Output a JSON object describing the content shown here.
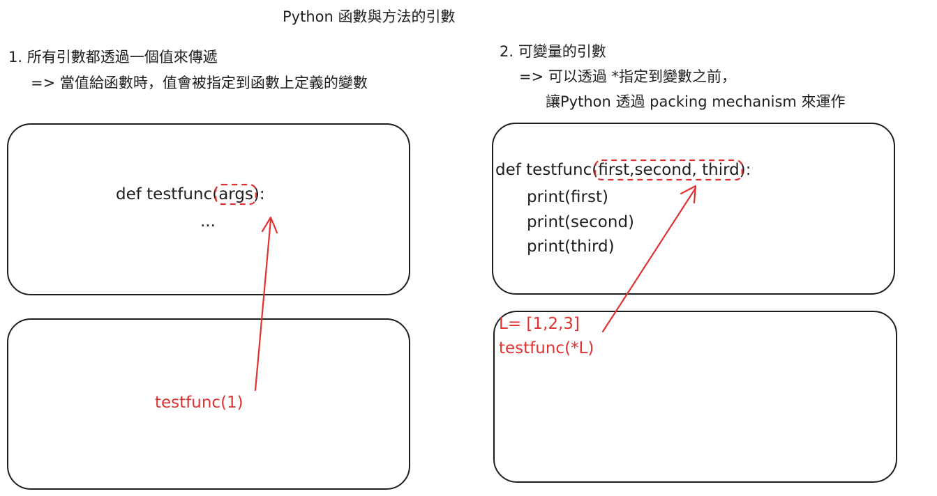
{
  "title": "Python  函數與方法的引數",
  "section1": {
    "heading": "1. 所有引數都透過一個值來傳遞",
    "subtext": "=> 當值給函數時，值會被指定到函數上定義的變數",
    "definition_box": {
      "def_prefix": "def testfunc(",
      "param": "args",
      "def_suffix": "):",
      "body": "..."
    },
    "call_box": {
      "call": "testfunc(1)"
    }
  },
  "section2": {
    "heading": "2. 可變量的引數",
    "subtext_line1": "=> 可以透過 *指定到變數之前，",
    "subtext_line2": "讓Python 透過 packing mechanism 來運作",
    "definition_box": {
      "def_prefix": "def testfunc(",
      "params": "first,second, third",
      "def_suffix": "):",
      "body_lines": [
        "print(first)",
        "print(second)",
        "print(third)"
      ]
    },
    "call_box": {
      "assign": "L= [1,2,3]",
      "call": "testfunc(*L)"
    }
  },
  "colors": {
    "ink": "#1e1e1e",
    "accent": "#e03131"
  }
}
